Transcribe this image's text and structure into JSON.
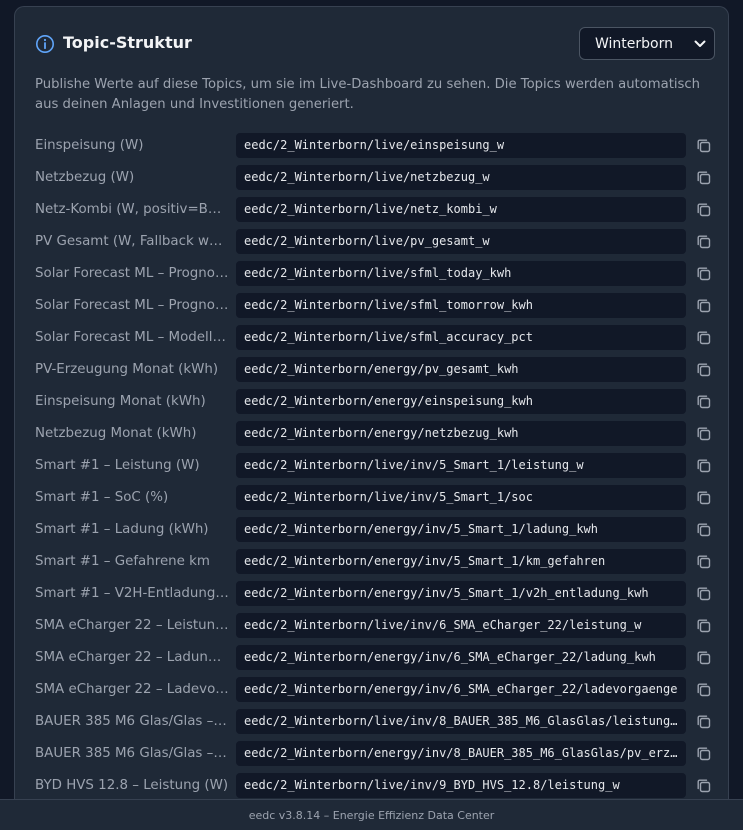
{
  "header": {
    "title": "Topic-Struktur",
    "info_icon": "info-circle-icon",
    "selected_installation": "Winterborn",
    "accent_color": "#3b82f6"
  },
  "description": "Publishe Werte auf diese Topics, um sie im Live-Dashboard zu sehen. Die Topics werden automatisch aus deinen Anlagen und Investitionen generiert.",
  "topics": [
    {
      "label": "Einspeisung (W)",
      "topic": "eedc/2_Winterborn/live/einspeisung_w"
    },
    {
      "label": "Netzbezug (W)",
      "topic": "eedc/2_Winterborn/live/netzbezug_w"
    },
    {
      "label": "Netz-Kombi (W, positiv=Bez…",
      "topic": "eedc/2_Winterborn/live/netz_kombi_w"
    },
    {
      "label": "PV Gesamt (W, Fallback wen…",
      "topic": "eedc/2_Winterborn/live/pv_gesamt_w"
    },
    {
      "label": "Solar Forecast ML – Prognos…",
      "topic": "eedc/2_Winterborn/live/sfml_today_kwh"
    },
    {
      "label": "Solar Forecast ML – Prognos…",
      "topic": "eedc/2_Winterborn/live/sfml_tomorrow_kwh"
    },
    {
      "label": "Solar Forecast ML – Modellg…",
      "topic": "eedc/2_Winterborn/live/sfml_accuracy_pct"
    },
    {
      "label": "PV-Erzeugung Monat (kWh)",
      "topic": "eedc/2_Winterborn/energy/pv_gesamt_kwh"
    },
    {
      "label": "Einspeisung Monat (kWh)",
      "topic": "eedc/2_Winterborn/energy/einspeisung_kwh"
    },
    {
      "label": "Netzbezug Monat (kWh)",
      "topic": "eedc/2_Winterborn/energy/netzbezug_kwh"
    },
    {
      "label": "Smart #1 – Leistung (W)",
      "topic": "eedc/2_Winterborn/live/inv/5_Smart_1/leistung_w"
    },
    {
      "label": "Smart #1 – SoC (%)",
      "topic": "eedc/2_Winterborn/live/inv/5_Smart_1/soc"
    },
    {
      "label": "Smart #1 – Ladung (kWh)",
      "topic": "eedc/2_Winterborn/energy/inv/5_Smart_1/ladung_kwh"
    },
    {
      "label": "Smart #1 – Gefahrene km",
      "topic": "eedc/2_Winterborn/energy/inv/5_Smart_1/km_gefahren"
    },
    {
      "label": "Smart #1 – V2H-Entladung (…",
      "topic": "eedc/2_Winterborn/energy/inv/5_Smart_1/v2h_entladung_kwh"
    },
    {
      "label": "SMA eCharger 22 – Leistung…",
      "topic": "eedc/2_Winterborn/live/inv/6_SMA_eCharger_22/leistung_w"
    },
    {
      "label": "SMA eCharger 22 – Ladung (…",
      "topic": "eedc/2_Winterborn/energy/inv/6_SMA_eCharger_22/ladung_kwh"
    },
    {
      "label": "SMA eCharger 22 – Ladevor…",
      "topic": "eedc/2_Winterborn/energy/inv/6_SMA_eCharger_22/ladevorgaenge"
    },
    {
      "label": "BAUER 385 M6 Glas/Glas – L…",
      "topic": "eedc/2_Winterborn/live/inv/8_BAUER_385_M6_GlasGlas/leistung…"
    },
    {
      "label": "BAUER 385 M6 Glas/Glas – P…",
      "topic": "eedc/2_Winterborn/energy/inv/8_BAUER_385_M6_GlasGlas/pv_erz…"
    },
    {
      "label": "BYD HVS 12.8 – Leistung (W)",
      "topic": "eedc/2_Winterborn/live/inv/9_BYD_HVS_12.8/leistung_w"
    }
  ],
  "copy_icon": "copy-icon",
  "footer": {
    "text": "eedc v3.8.14 – Energie Effizienz Data Center"
  }
}
